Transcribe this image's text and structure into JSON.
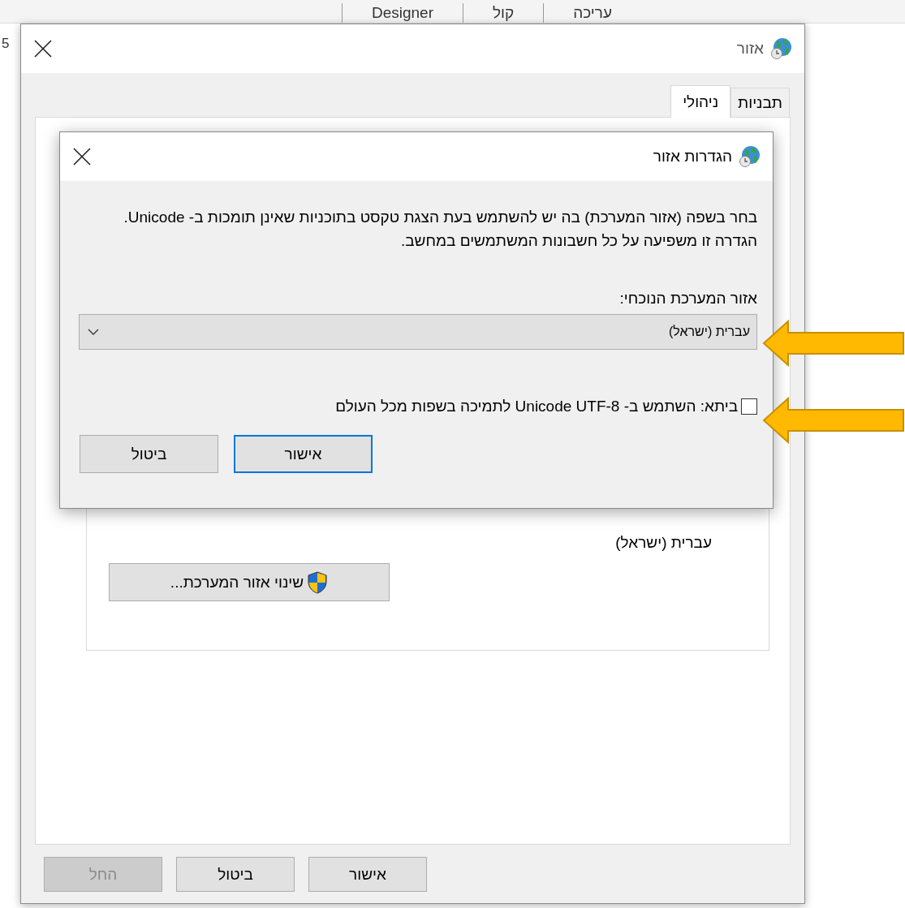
{
  "background_app": {
    "tabs": [
      "עריכה",
      "קול",
      "Designer"
    ],
    "edge_text": "5"
  },
  "window": {
    "title": "אזור",
    "tabs": [
      {
        "label": "תבניות",
        "selected": false
      },
      {
        "label": "ניהולי",
        "selected": true
      }
    ],
    "panel": {
      "current_locale": "עברית (ישראל)",
      "change_button": "שינוי אזור המערכת..."
    },
    "buttons": [
      {
        "label": "אישור",
        "disabled": false
      },
      {
        "label": "ביטול",
        "disabled": false
      },
      {
        "label": "החל",
        "disabled": true
      }
    ]
  },
  "dialog": {
    "title": "הגדרות אזור",
    "description": "בחר בשפה (אזור המערכת) בה יש להשתמש בעת הצגת טקסט בתוכניות שאינן תומכות ב- Unicode. הגדרה זו משפיעה על כל חשבונות המשתמשים במחשב.",
    "field_label": "אזור המערכת הנוכחי:",
    "dropdown": {
      "value": "עברית (ישראל)"
    },
    "beta_checkbox": {
      "label": "ביתא: השתמש ב- Unicode UTF-8 לתמיכה בשפות מכל העולם",
      "checked": false
    },
    "buttons": [
      {
        "label": "אישור",
        "default": true
      },
      {
        "label": "ביטול",
        "default": false
      }
    ]
  }
}
